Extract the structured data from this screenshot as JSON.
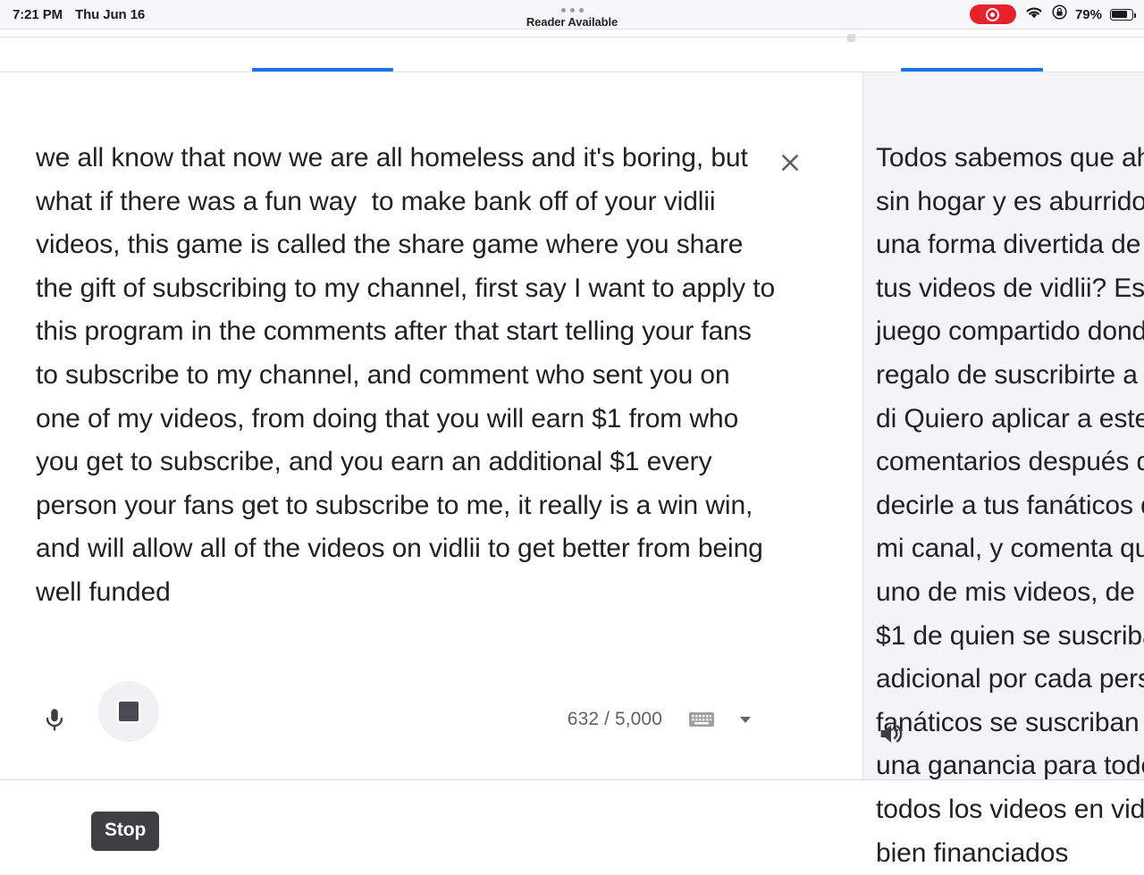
{
  "status_bar": {
    "time": "7:21 PM",
    "date": "Thu Jun 16",
    "reader_label": "Reader Available",
    "battery_percent": "79%",
    "battery_level": 79,
    "recording_icon": "screen-recording-icon",
    "wifi_icon": "wifi-icon",
    "lock_icon": "lock-rotation-icon",
    "battery_icon": "battery-icon",
    "dots_icon": "three-dots-icon",
    "bg_color": "#f7f7f9"
  },
  "accent_color": "#1a73e8",
  "translate": {
    "source": {
      "text": "we all know that now we are all homeless and it's boring, but what if there was a fun way  to make bank off of your vidlii videos, this game is called the share game where you share the gift of subscribing to my channel, first say I want to apply to this program in the comments after that start telling your fans to subscribe to my channel, and comment who sent you on one of my videos, from doing that you will earn $1 from who you get to subscribe, and you earn an additional $1 every person your fans get to subscribe to me, it really is a win win, and will allow all of the videos on vidlii to get better from being well funded",
      "clear_icon": "close-icon",
      "mic_icon": "microphone-icon",
      "stop_icon": "stop-square-icon",
      "char_count": "632 / 5,000",
      "keyboard_icon": "keyboard-icon",
      "keyboard_caret_icon": "chevron-down-icon"
    },
    "target": {
      "text": "Todos sabemos que ahora todos estamos sin hogar y es aburrido, pero ¿y si hubiera una forma divertida de ganar dinero con tus videos de vidlii? Este juego se llama el juego compartido donde compartes el regalo de suscribirte a mi canal, primero di Quiero aplicar a este programa en los comentarios después de eso comienza a decirle a tus fanáticos que se suscriban a mi canal, y comenta quién te los envió a uno de mis videos, de hacer eso ganarás $1 de quien se suscriba, y ganas $1 adicional por cada persona que sus fanáticos se suscriban a mí, realmente es una ganancia para todos, y permitirá que todos los videos en vidlii mejoren de ser bien financiados",
      "speaker_icon": "volume-up-icon",
      "bg_color": "#f4f4f7"
    },
    "tooltip": "Stop"
  }
}
